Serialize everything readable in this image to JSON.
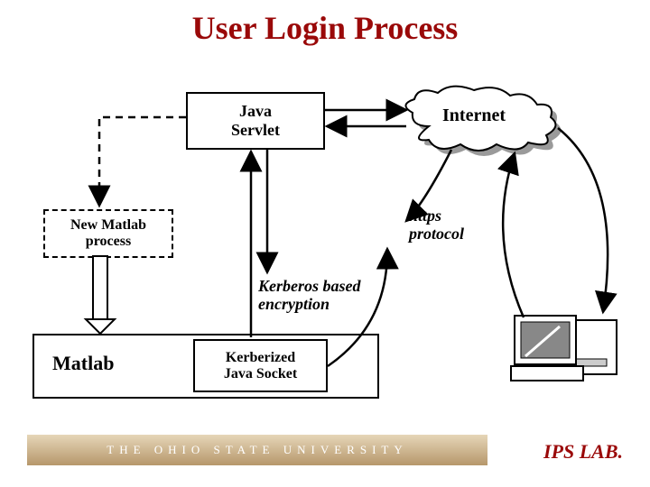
{
  "title": "User Login Process",
  "nodes": {
    "java_servlet_line1": "Java",
    "java_servlet_line2": "Servlet",
    "internet": "Internet",
    "new_matlab_line1": "New Matlab",
    "new_matlab_line2": "process",
    "matlab": "Matlab",
    "kerb_socket_line1": "Kerberized",
    "kerb_socket_line2": "Java Socket"
  },
  "labels": {
    "https_line1": "https",
    "https_line2": "protocol",
    "kerb_enc_line1": "Kerberos based",
    "kerb_enc_line2": "encryption"
  },
  "footer": {
    "university": "THE OHIO STATE UNIVERSITY",
    "lab": "IPS LAB."
  }
}
